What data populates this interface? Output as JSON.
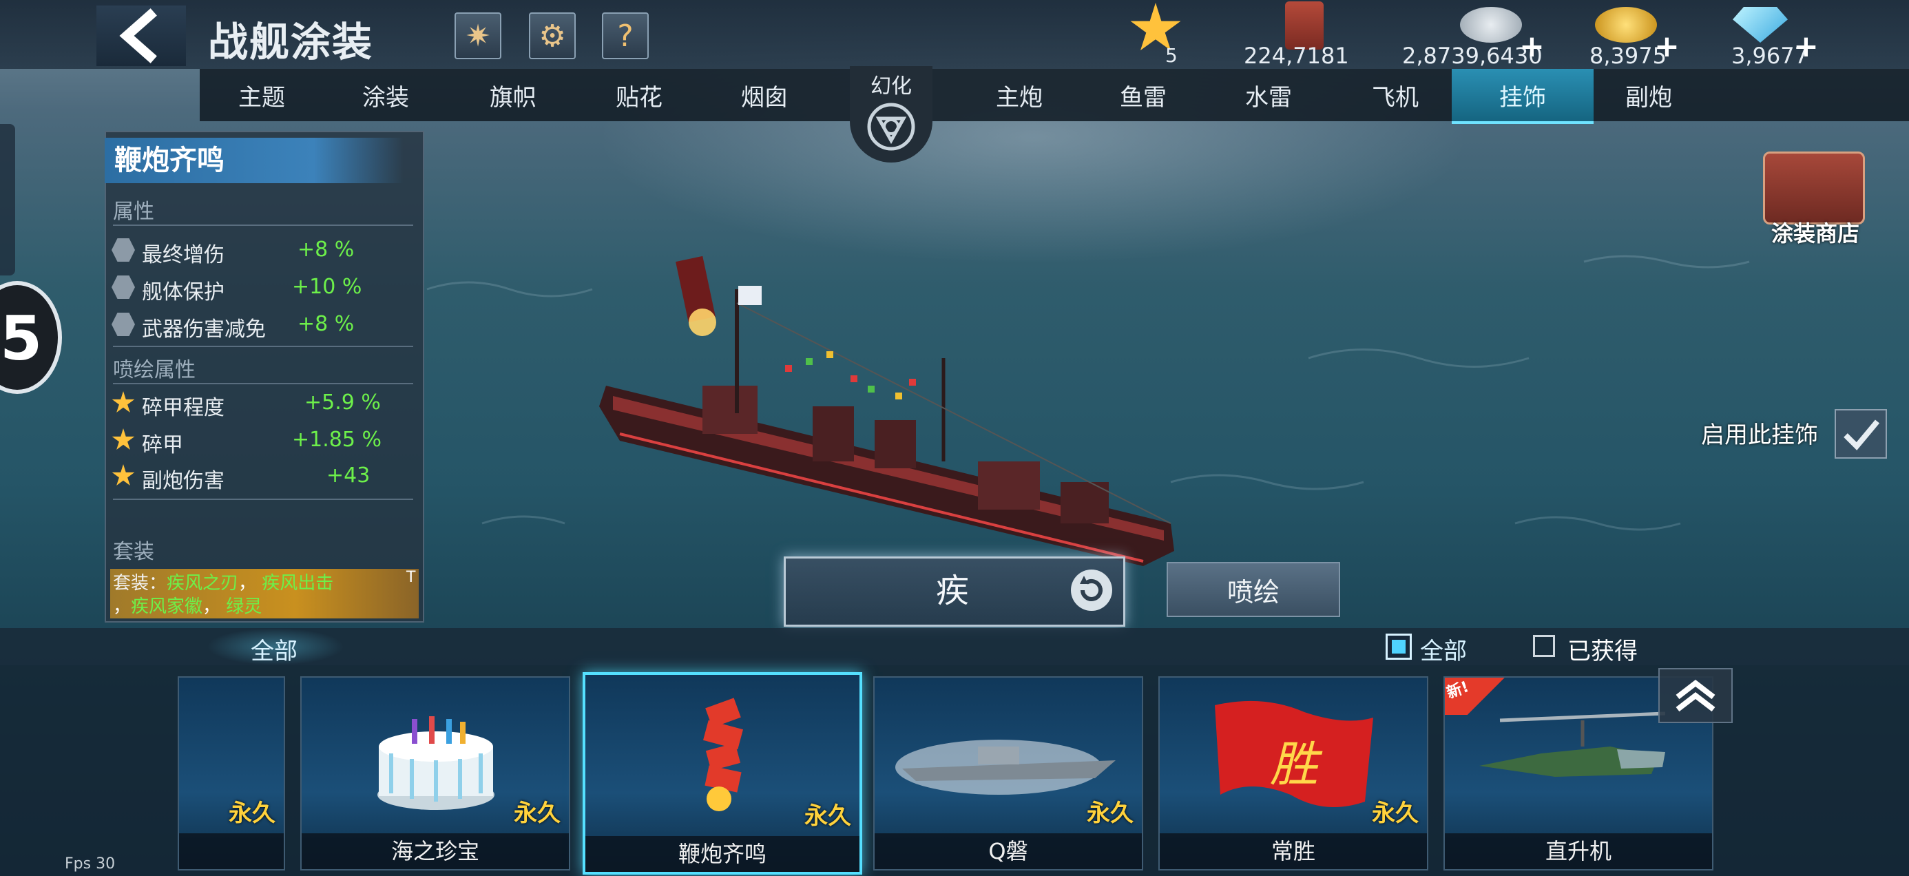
{
  "header": {
    "title": "战舰涂装"
  },
  "resources": {
    "stars": "5",
    "paint": "224,7181",
    "silver": "2,8739,6430",
    "gold": "8,3975",
    "diamond": "3,9677"
  },
  "tabs_left": [
    "主题",
    "涂装",
    "旗帜",
    "贴花",
    "烟囱"
  ],
  "transform_label": "幻化",
  "tabs_right": [
    "主炮",
    "鱼雷",
    "水雷",
    "飞机",
    "挂饰",
    "副炮"
  ],
  "active_tab": "挂饰",
  "info_panel": {
    "title": "鞭炮齐鸣",
    "attributes_heading": "属性",
    "attributes": [
      {
        "name": "最终增伤",
        "value": "+8 %"
      },
      {
        "name": "舰体保护",
        "value": "+10 %"
      },
      {
        "name": "武器伤害减免",
        "value": "+8 %"
      }
    ],
    "spray_heading": "喷绘属性",
    "spray_attributes": [
      {
        "name": "碎甲程度",
        "value": "+5.9 %"
      },
      {
        "name": "碎甲",
        "value": "+1.85 %"
      },
      {
        "name": "副炮伤害",
        "value": "+43"
      }
    ],
    "set_heading": "套装",
    "set_prefix": "套装：",
    "set_items": [
      "疾风之刃",
      "疾风出击",
      "疾风家徽",
      "绿灵"
    ]
  },
  "shop_label": "涂装商店",
  "equip_label": "启用此挂饰",
  "skin_button_label": "疾",
  "spray_button_label": "喷绘",
  "left_badge": "5",
  "filters": {
    "left_tab": "全部",
    "all_label": "全部",
    "obtained_label": "已获得"
  },
  "items": [
    {
      "name": "",
      "tag": "永久"
    },
    {
      "name": "海之珍宝",
      "tag": "永久"
    },
    {
      "name": "鞭炮齐鸣",
      "tag": "永久",
      "selected": true
    },
    {
      "name": "Q磐",
      "tag": "永久"
    },
    {
      "name": "常胜",
      "tag": "永久"
    },
    {
      "name": "直升机",
      "tag": "",
      "badge": "新!"
    }
  ],
  "flag_glyph": "胜",
  "fps": "Fps 30"
}
